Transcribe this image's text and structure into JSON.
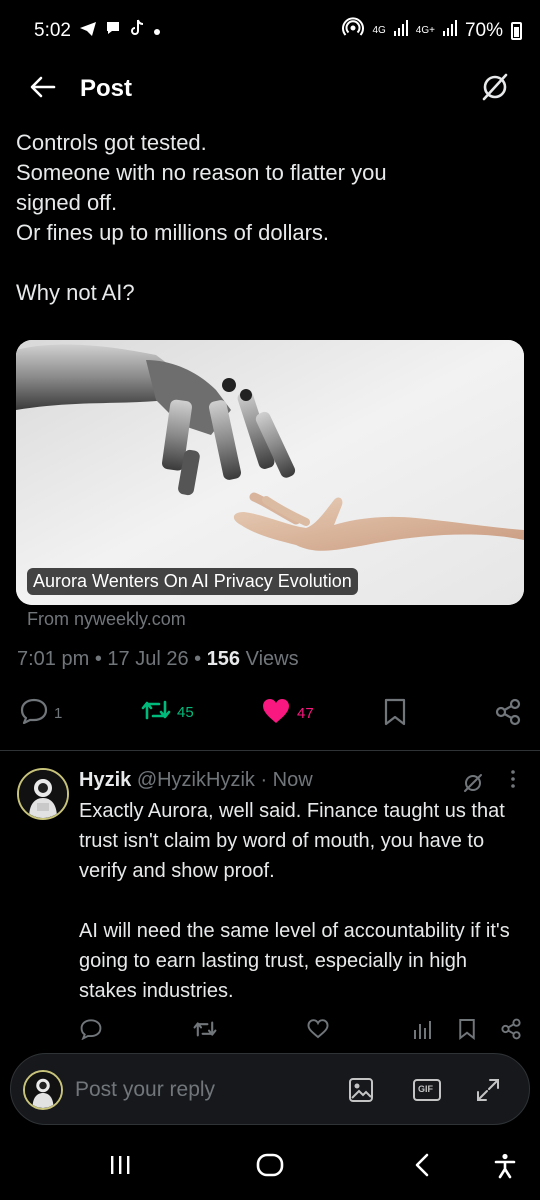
{
  "status": {
    "time": "5:02",
    "network_1": "4G",
    "network_2": "4G+",
    "battery": "70%"
  },
  "header": {
    "title": "Post",
    "back_icon": "back-arrow-icon",
    "grok_icon": "grok-icon"
  },
  "post": {
    "lines": [
      "Controls got tested.",
      "Someone with no reason to flatter you",
      "signed off.",
      "Or fines up to millions of dollars.",
      "",
      "Why not AI?"
    ],
    "card": {
      "caption": "Aurora Wenters On AI Privacy Evolution",
      "source": "From nyweekly.com"
    },
    "time": "7:01 pm",
    "date": "17 Jul 26",
    "views_count": "156",
    "views_label": "Views",
    "replies": "1",
    "reposts": "45",
    "likes": "47",
    "colors": {
      "repost": "#00ba7c",
      "like": "#f91880"
    }
  },
  "reply": {
    "name": "Hyzik",
    "handle": "@HyzikHyzik",
    "time": "Now",
    "paragraph_1": "Exactly Aurora, well said. Finance taught us that trust isn't claim by word of mouth, you have to verify and show proof.",
    "paragraph_2": "AI will need the same level of accountability if it's going to earn lasting trust, especially in high stakes industries."
  },
  "composer": {
    "placeholder": "Post your reply",
    "gif_label": "GIF"
  }
}
